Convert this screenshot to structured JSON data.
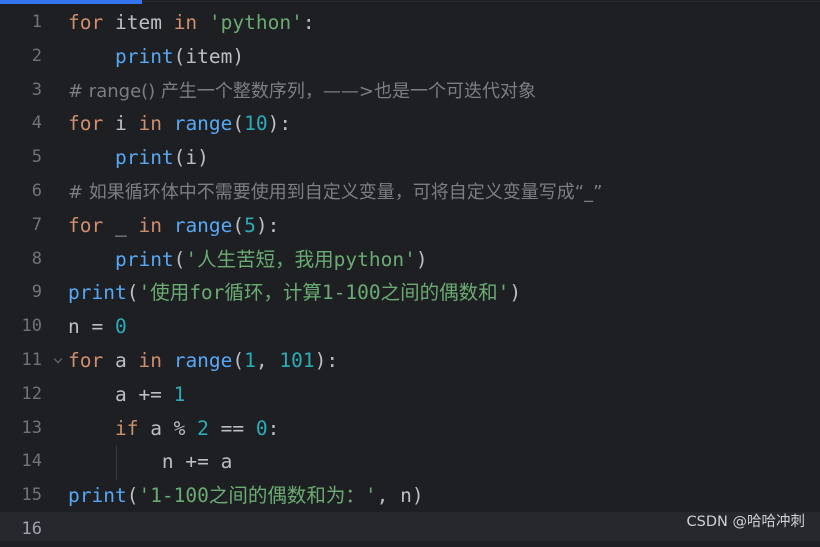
{
  "editor": {
    "accent_color": "#3574f0",
    "active_line": 16,
    "fold_marker_line": 11,
    "colors": {
      "keyword": "#cf8e6d",
      "builtin": "#56a8f5",
      "string": "#6aab73",
      "number": "#2aacb8",
      "comment": "#7a7e85",
      "text": "#bcbec4",
      "background": "#1e1f22"
    },
    "lines": [
      {
        "number": "1",
        "tokens": [
          {
            "t": "for",
            "c": "kw"
          },
          {
            "t": " item ",
            "c": ""
          },
          {
            "t": "in",
            "c": "kw"
          },
          {
            "t": " ",
            "c": ""
          },
          {
            "t": "'python'",
            "c": "str"
          },
          {
            "t": ":",
            "c": ""
          }
        ]
      },
      {
        "number": "2",
        "tokens": [
          {
            "t": "    ",
            "c": ""
          },
          {
            "t": "print",
            "c": "fn"
          },
          {
            "t": "(item)",
            "c": ""
          }
        ]
      },
      {
        "number": "3",
        "tokens": [
          {
            "t": "# range() 产生一个整数序列，——>也是一个可迭代对象",
            "c": "cmt"
          }
        ]
      },
      {
        "number": "4",
        "tokens": [
          {
            "t": "for",
            "c": "kw"
          },
          {
            "t": " i ",
            "c": ""
          },
          {
            "t": "in",
            "c": "kw"
          },
          {
            "t": " ",
            "c": ""
          },
          {
            "t": "range",
            "c": "fn"
          },
          {
            "t": "(",
            "c": ""
          },
          {
            "t": "10",
            "c": "num"
          },
          {
            "t": "):",
            "c": ""
          }
        ]
      },
      {
        "number": "5",
        "tokens": [
          {
            "t": "    ",
            "c": ""
          },
          {
            "t": "print",
            "c": "fn"
          },
          {
            "t": "(i)",
            "c": ""
          }
        ]
      },
      {
        "number": "6",
        "tokens": [
          {
            "t": "# 如果循环体中不需要使用到自定义变量，可将自定义变量写成“_”",
            "c": "cmt"
          }
        ]
      },
      {
        "number": "7",
        "tokens": [
          {
            "t": "for",
            "c": "kw"
          },
          {
            "t": " _ ",
            "c": ""
          },
          {
            "t": "in",
            "c": "kw"
          },
          {
            "t": " ",
            "c": ""
          },
          {
            "t": "range",
            "c": "fn"
          },
          {
            "t": "(",
            "c": ""
          },
          {
            "t": "5",
            "c": "num"
          },
          {
            "t": "):",
            "c": ""
          }
        ]
      },
      {
        "number": "8",
        "tokens": [
          {
            "t": "    ",
            "c": ""
          },
          {
            "t": "print",
            "c": "fn"
          },
          {
            "t": "(",
            "c": ""
          },
          {
            "t": "'人生苦短，我用python'",
            "c": "str"
          },
          {
            "t": ")",
            "c": ""
          }
        ]
      },
      {
        "number": "9",
        "tokens": [
          {
            "t": "print",
            "c": "fn"
          },
          {
            "t": "(",
            "c": ""
          },
          {
            "t": "'使用for循环，计算1-100之间的偶数和'",
            "c": "str"
          },
          {
            "t": ")",
            "c": ""
          }
        ]
      },
      {
        "number": "10",
        "tokens": [
          {
            "t": "n = ",
            "c": ""
          },
          {
            "t": "0",
            "c": "num"
          }
        ]
      },
      {
        "number": "11",
        "tokens": [
          {
            "t": "for",
            "c": "kw"
          },
          {
            "t": " a ",
            "c": ""
          },
          {
            "t": "in",
            "c": "kw"
          },
          {
            "t": " ",
            "c": ""
          },
          {
            "t": "range",
            "c": "fn"
          },
          {
            "t": "(",
            "c": ""
          },
          {
            "t": "1",
            "c": "num"
          },
          {
            "t": ", ",
            "c": ""
          },
          {
            "t": "101",
            "c": "num"
          },
          {
            "t": "):",
            "c": ""
          }
        ]
      },
      {
        "number": "12",
        "tokens": [
          {
            "t": "    a += ",
            "c": ""
          },
          {
            "t": "1",
            "c": "num"
          }
        ]
      },
      {
        "number": "13",
        "tokens": [
          {
            "t": "    ",
            "c": ""
          },
          {
            "t": "if",
            "c": "kw"
          },
          {
            "t": " a % ",
            "c": ""
          },
          {
            "t": "2",
            "c": "num"
          },
          {
            "t": " == ",
            "c": ""
          },
          {
            "t": "0",
            "c": "num"
          },
          {
            "t": ":",
            "c": ""
          }
        ]
      },
      {
        "number": "14",
        "tokens": [
          {
            "t": "        n += a",
            "c": ""
          }
        ]
      },
      {
        "number": "15",
        "tokens": [
          {
            "t": "print",
            "c": "fn"
          },
          {
            "t": "(",
            "c": ""
          },
          {
            "t": "'1-100之间的偶数和为：'",
            "c": "str"
          },
          {
            "t": ", n)",
            "c": ""
          }
        ]
      },
      {
        "number": "16",
        "tokens": []
      }
    ]
  },
  "watermark": "CSDN @哈哈冲刺"
}
